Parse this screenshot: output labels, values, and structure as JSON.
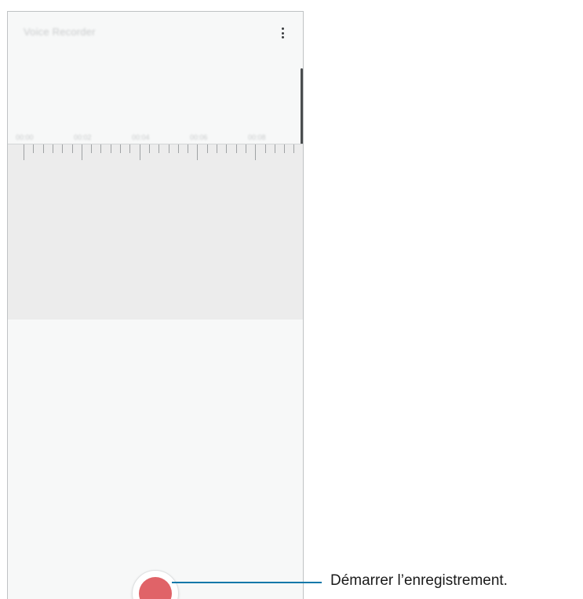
{
  "app": {
    "title": "Voice Recorder",
    "more_options_icon": "more-vertical-icon"
  },
  "timeline": {
    "labels": [
      "00:00",
      "00:02",
      "00:04",
      "00:06",
      "00:08"
    ]
  },
  "record": {
    "icon": "record-icon",
    "color": "#e06368"
  },
  "callout": {
    "text": "Démarrer l’enregistrement.",
    "line_color": "#0d78a9"
  }
}
